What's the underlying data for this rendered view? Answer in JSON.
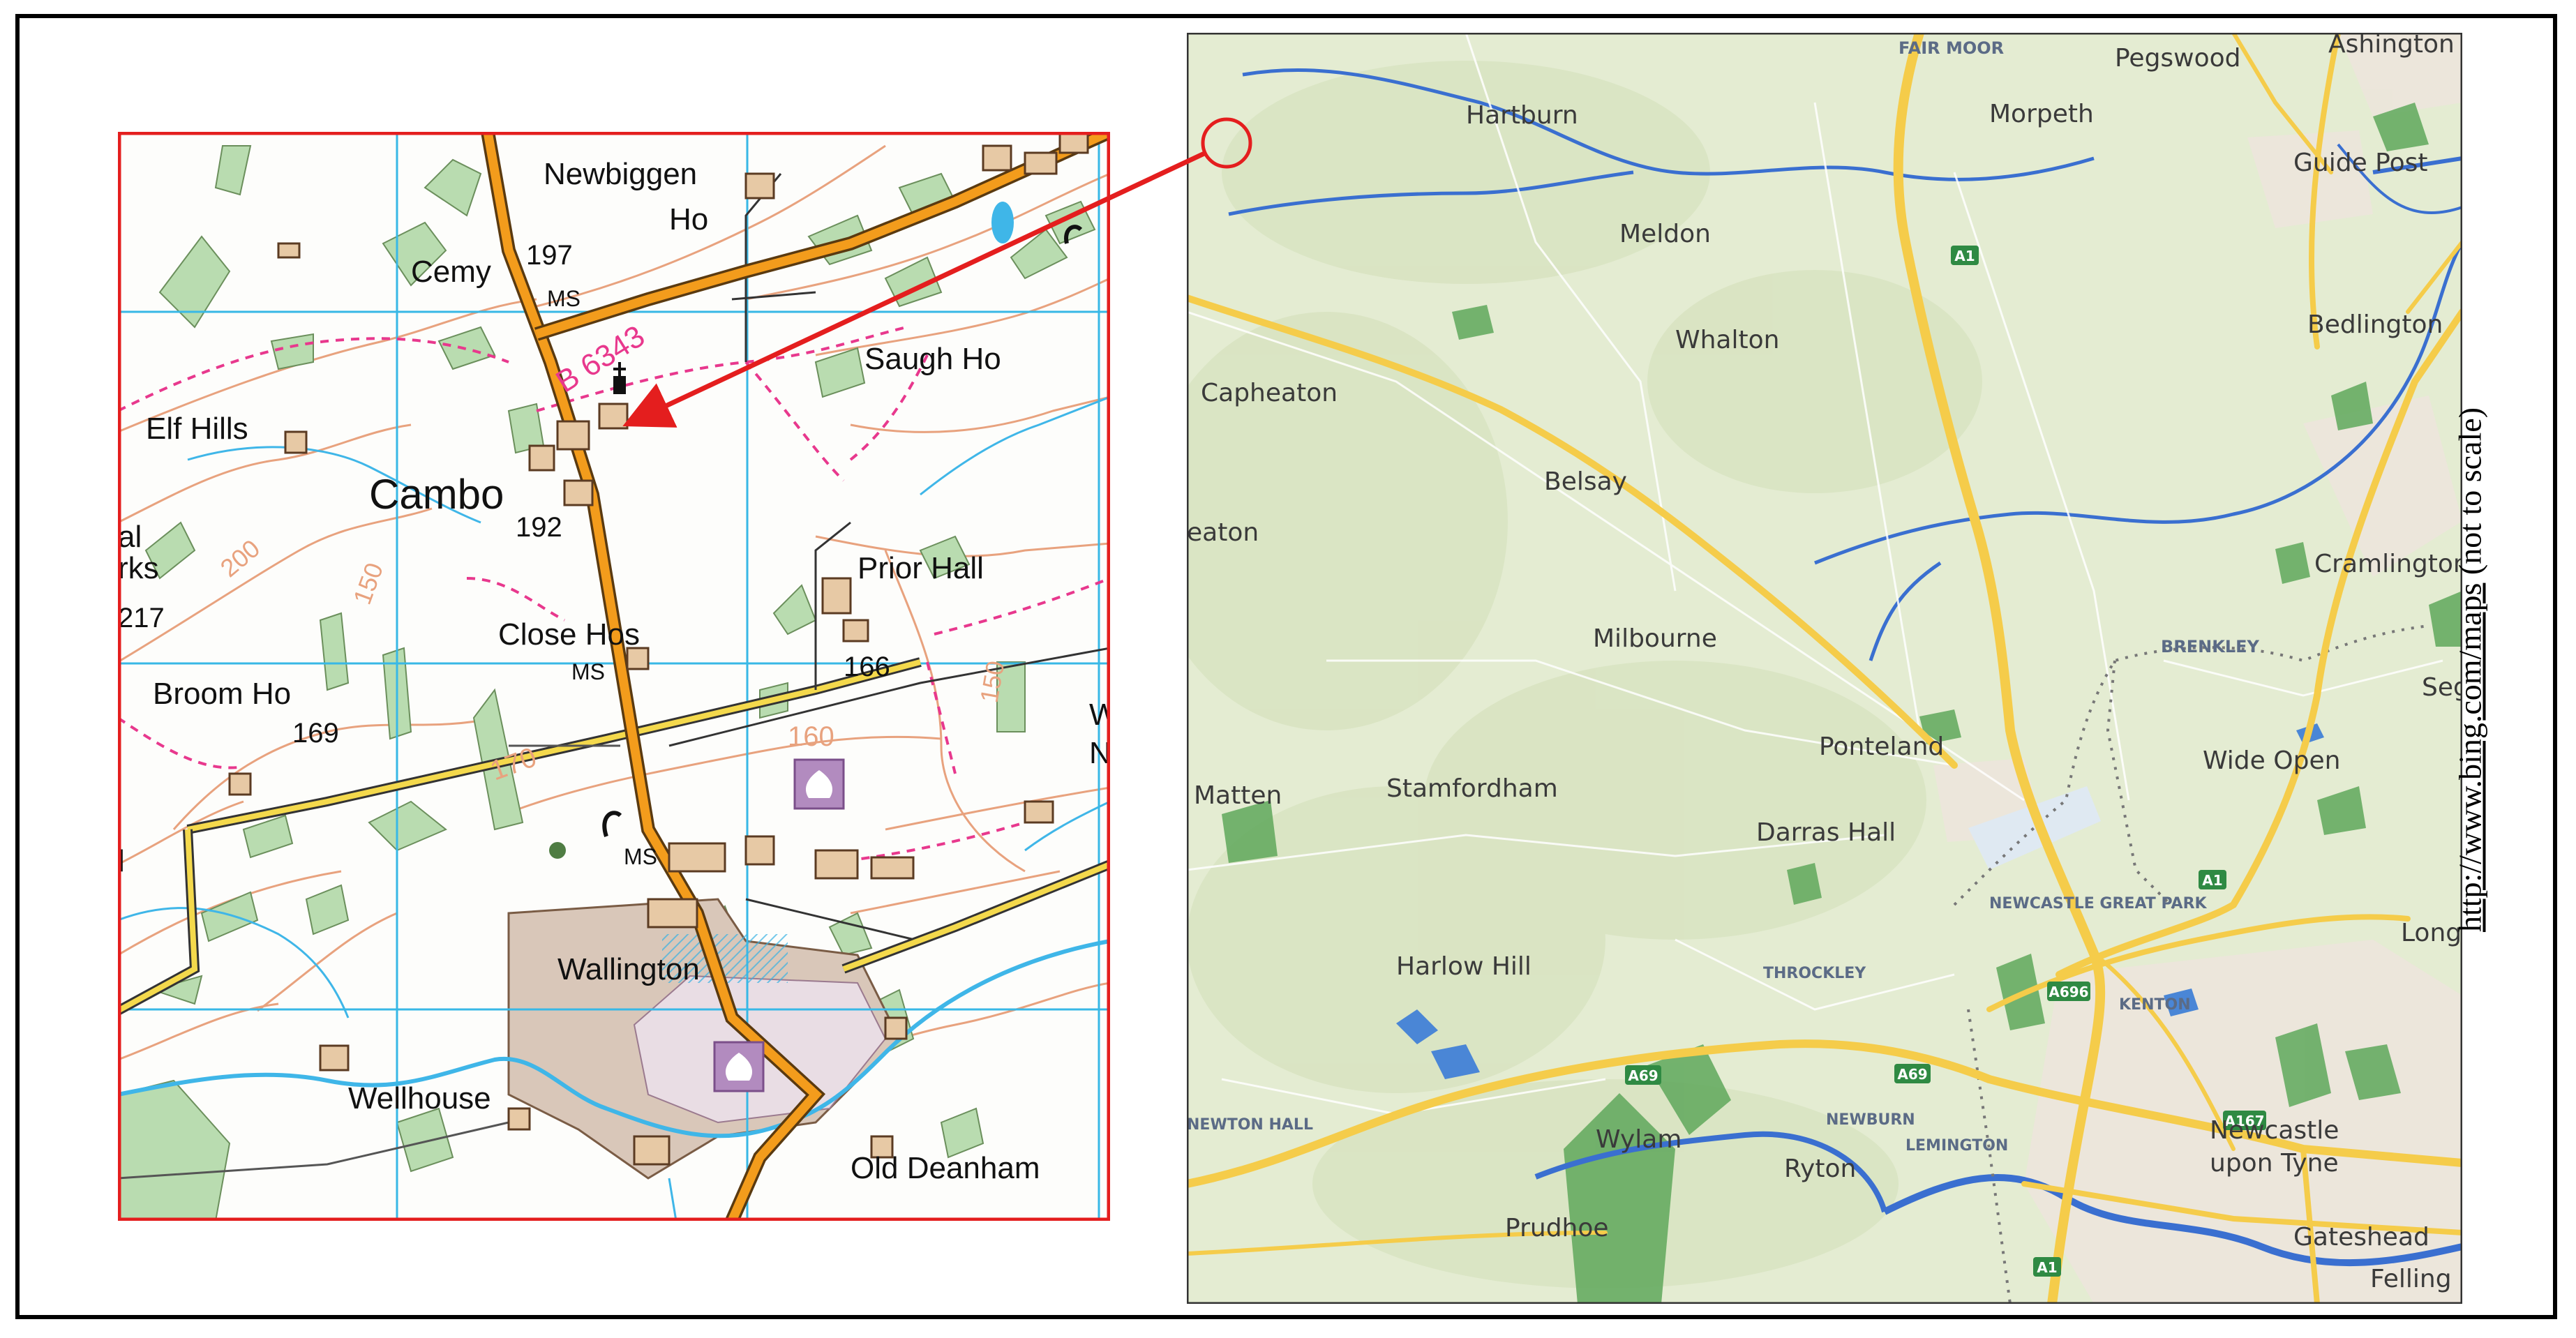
{
  "os_map": {
    "labels": {
      "newbiggen": "Newbiggen",
      "ho": "Ho",
      "cemy": "Cemy",
      "h197": "197",
      "ms1": "MS",
      "road": "B 6343",
      "saugh": "Saugh Ho",
      "elf": "Elf Hills",
      "cambo": "Cambo",
      "h192": "192",
      "h200": "200",
      "h150a": "150",
      "al": "al",
      "rks": "rks",
      "h217": "217",
      "prior": "Prior Hall",
      "close": "Close Hos",
      "ms2": "MS",
      "h166": "166",
      "h160": "160",
      "h150b": "150",
      "broom": "Broom Ho",
      "h169": "169",
      "h170": "170",
      "ms3": "MS",
      "w": "W",
      "n": "N",
      "l": "l",
      "wallington": "Wallington",
      "wellhouse": "Wellhouse",
      "deanham": "Old Deanham"
    },
    "colors": {
      "border": "#e41e1e",
      "grid": "#38b8e6",
      "road": "#f39c1c",
      "contour": "#e8a27e",
      "wood": "#b9dcb0",
      "path": "#e8388d",
      "water": "#3fb6e8"
    }
  },
  "bing_map": {
    "places": {
      "fairmoor": "FAIR MOOR",
      "pegswood": "Pegswood",
      "ashington": "Ashington",
      "hartburn": "Hartburn",
      "morpeth": "Morpeth",
      "guidepost": "Guide Post",
      "meldon": "Meldon",
      "whalton": "Whalton",
      "bedlington": "Bedlington",
      "capheaton": "Capheaton",
      "belsay": "Belsay",
      "eaton": "eaton",
      "cramlington": "Cramlington",
      "milbourne": "Milbourne",
      "brenkley": "BRENKLEY",
      "seg": "Seg",
      "ponteland": "Ponteland",
      "wideopen": "Wide Open",
      "matten": "Matten",
      "stamfordham": "Stamfordham",
      "darras": "Darras Hall",
      "greatpark": "NEWCASTLE GREAT PARK",
      "long": "Long",
      "harlow": "Harlow Hill",
      "throckley": "THROCKLEY",
      "kenton": "KENTON",
      "newtonhall": "NEWTON HALL",
      "newburn": "NEWBURN",
      "wylam": "Wylam",
      "lemington": "LEMINGTON",
      "newcastle1": "Newcastle",
      "newcastle2": "upon Tyne",
      "ryton": "Ryton",
      "prudhoe": "Prudhoe",
      "gateshead": "Gateshead",
      "felling": "Felling"
    },
    "shields": {
      "a1": "A1",
      "a696": "A696",
      "a69": "A69",
      "a167": "A167"
    },
    "colors": {
      "land": "#e4ecd2",
      "motorway": "#f5cc4a",
      "river": "#3a6fd0",
      "forest": "#5fa85c"
    }
  },
  "source_note": {
    "url": "http://www.bing.com/maps",
    "suffix": " (not to scale)"
  }
}
